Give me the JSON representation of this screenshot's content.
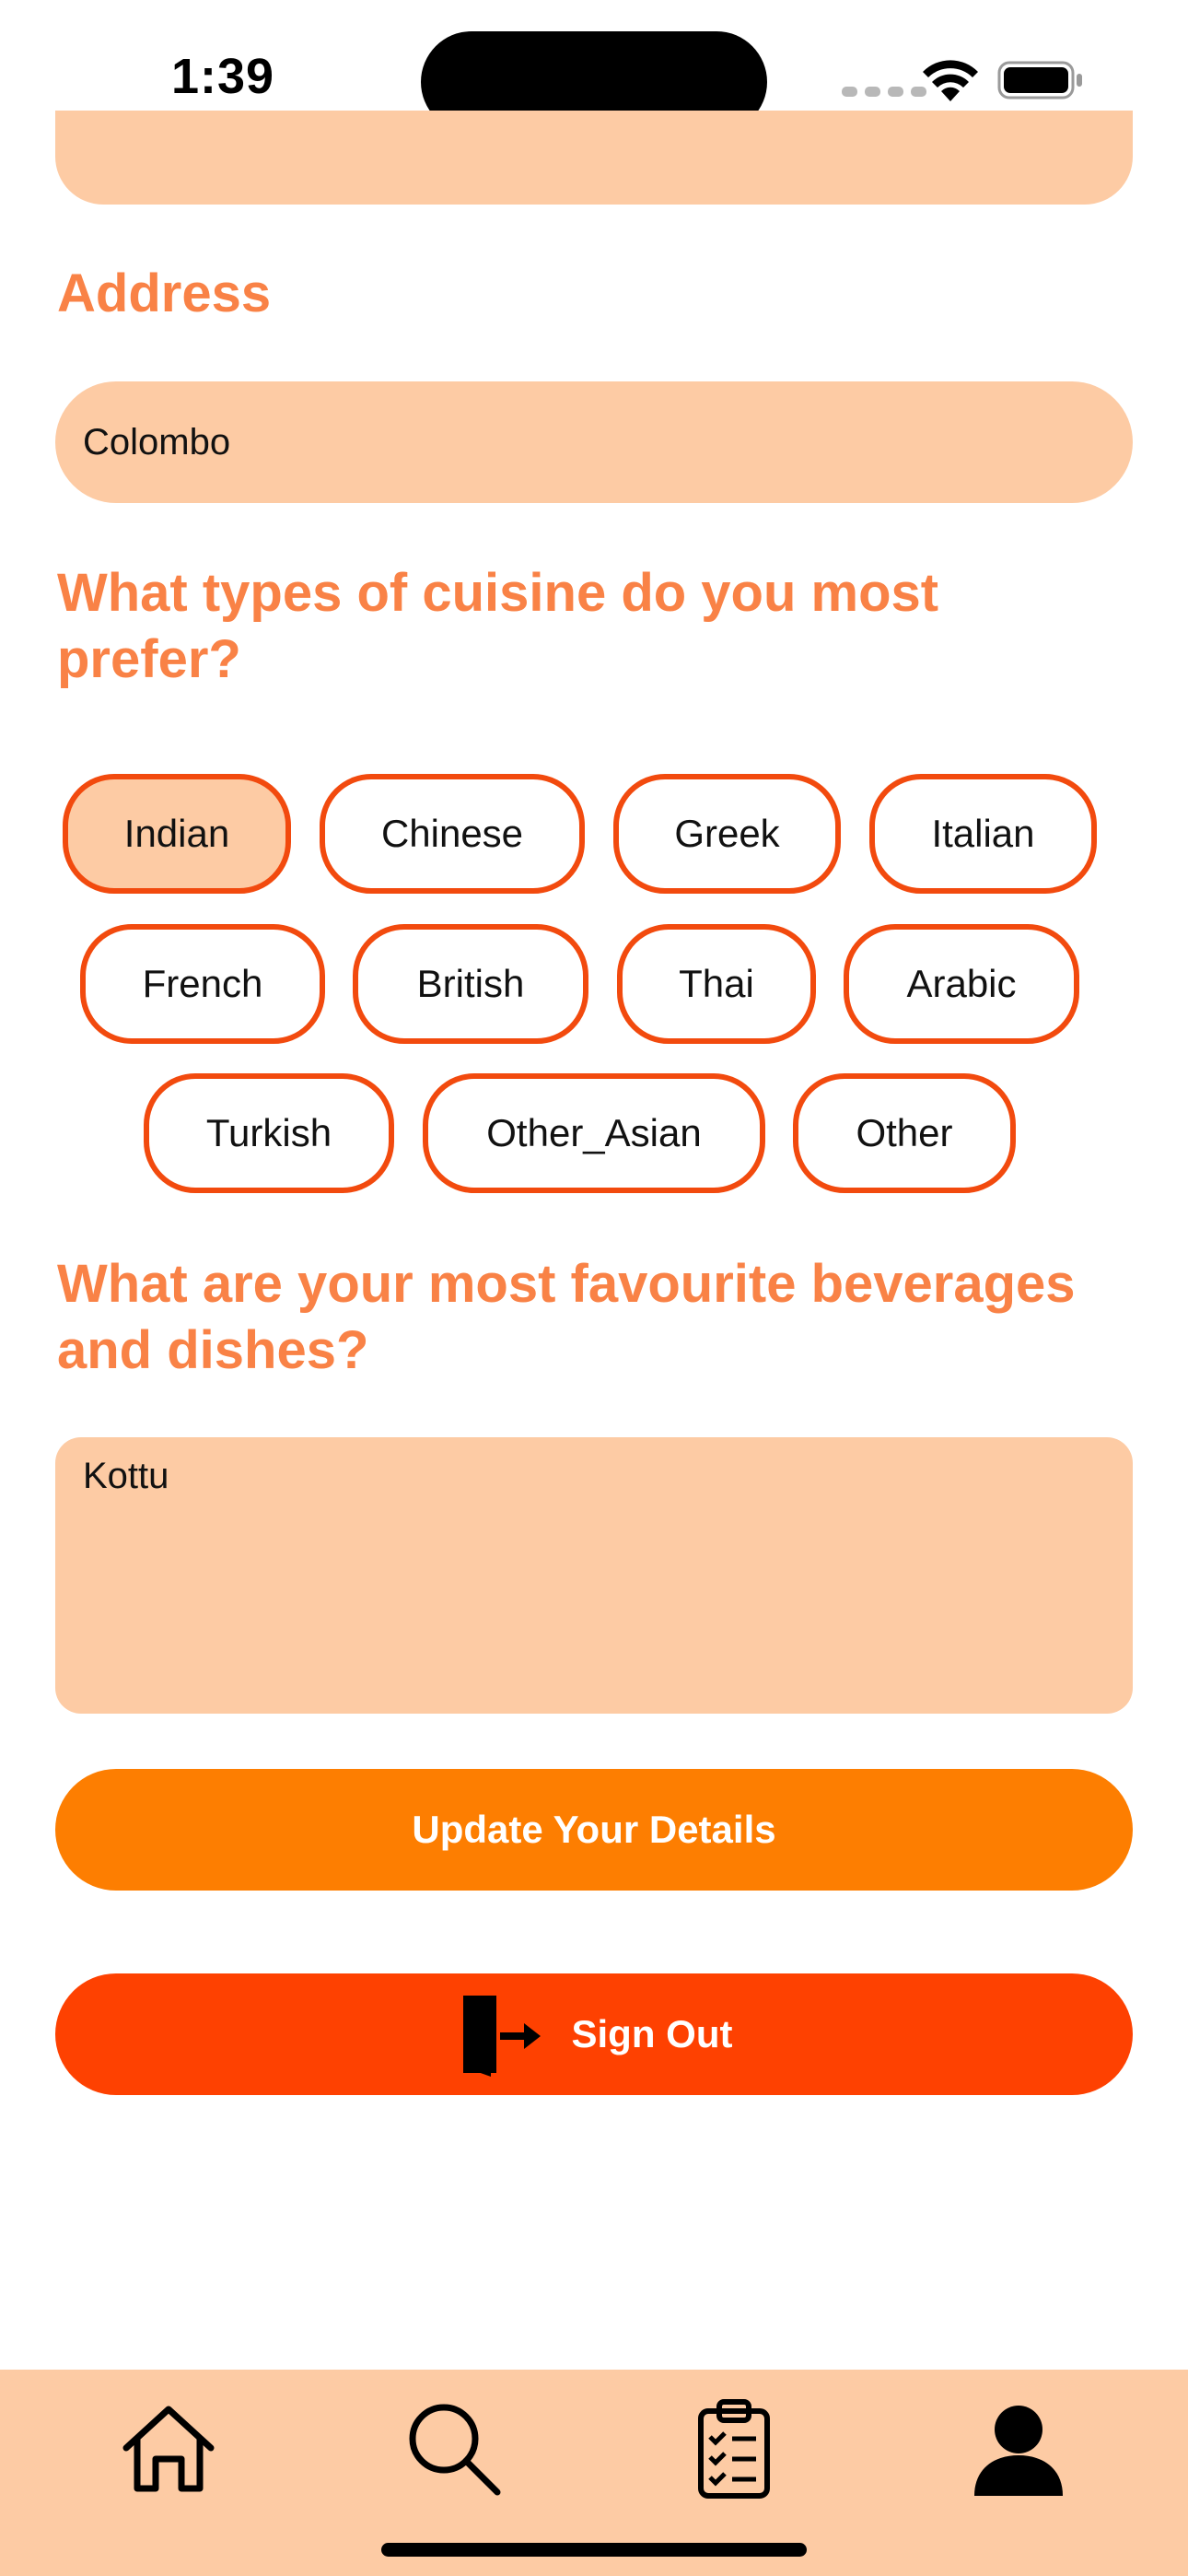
{
  "status_bar": {
    "time": "1:39"
  },
  "address": {
    "label": "Address",
    "value": "Colombo"
  },
  "cuisine": {
    "question": "What types of cuisine do you most prefer?",
    "options": [
      {
        "label": "Indian",
        "selected": true
      },
      {
        "label": "Chinese",
        "selected": false
      },
      {
        "label": "Greek",
        "selected": false
      },
      {
        "label": "Italian",
        "selected": false
      },
      {
        "label": "French",
        "selected": false
      },
      {
        "label": "British",
        "selected": false
      },
      {
        "label": "Thai",
        "selected": false
      },
      {
        "label": "Arabic",
        "selected": false
      },
      {
        "label": "Turkish",
        "selected": false
      },
      {
        "label": "Other_Asian",
        "selected": false
      },
      {
        "label": "Other",
        "selected": false
      }
    ]
  },
  "favourites": {
    "question": "What are your most favourite beverages and dishes?",
    "value": "Kottu"
  },
  "actions": {
    "update_label": "Update Your Details",
    "signout_label": "Sign Out"
  },
  "colors": {
    "accent_label": "#f98246",
    "field_bg": "#fdcba4",
    "chip_border": "#f24a0e",
    "update_button": "#fd7e01",
    "signout_button": "#fe4101"
  },
  "tab_bar": {
    "tabs": [
      {
        "icon": "home-icon",
        "active": false
      },
      {
        "icon": "search-icon",
        "active": false
      },
      {
        "icon": "clipboard-checklist-icon",
        "active": false
      },
      {
        "icon": "person-icon",
        "active": true
      }
    ]
  }
}
